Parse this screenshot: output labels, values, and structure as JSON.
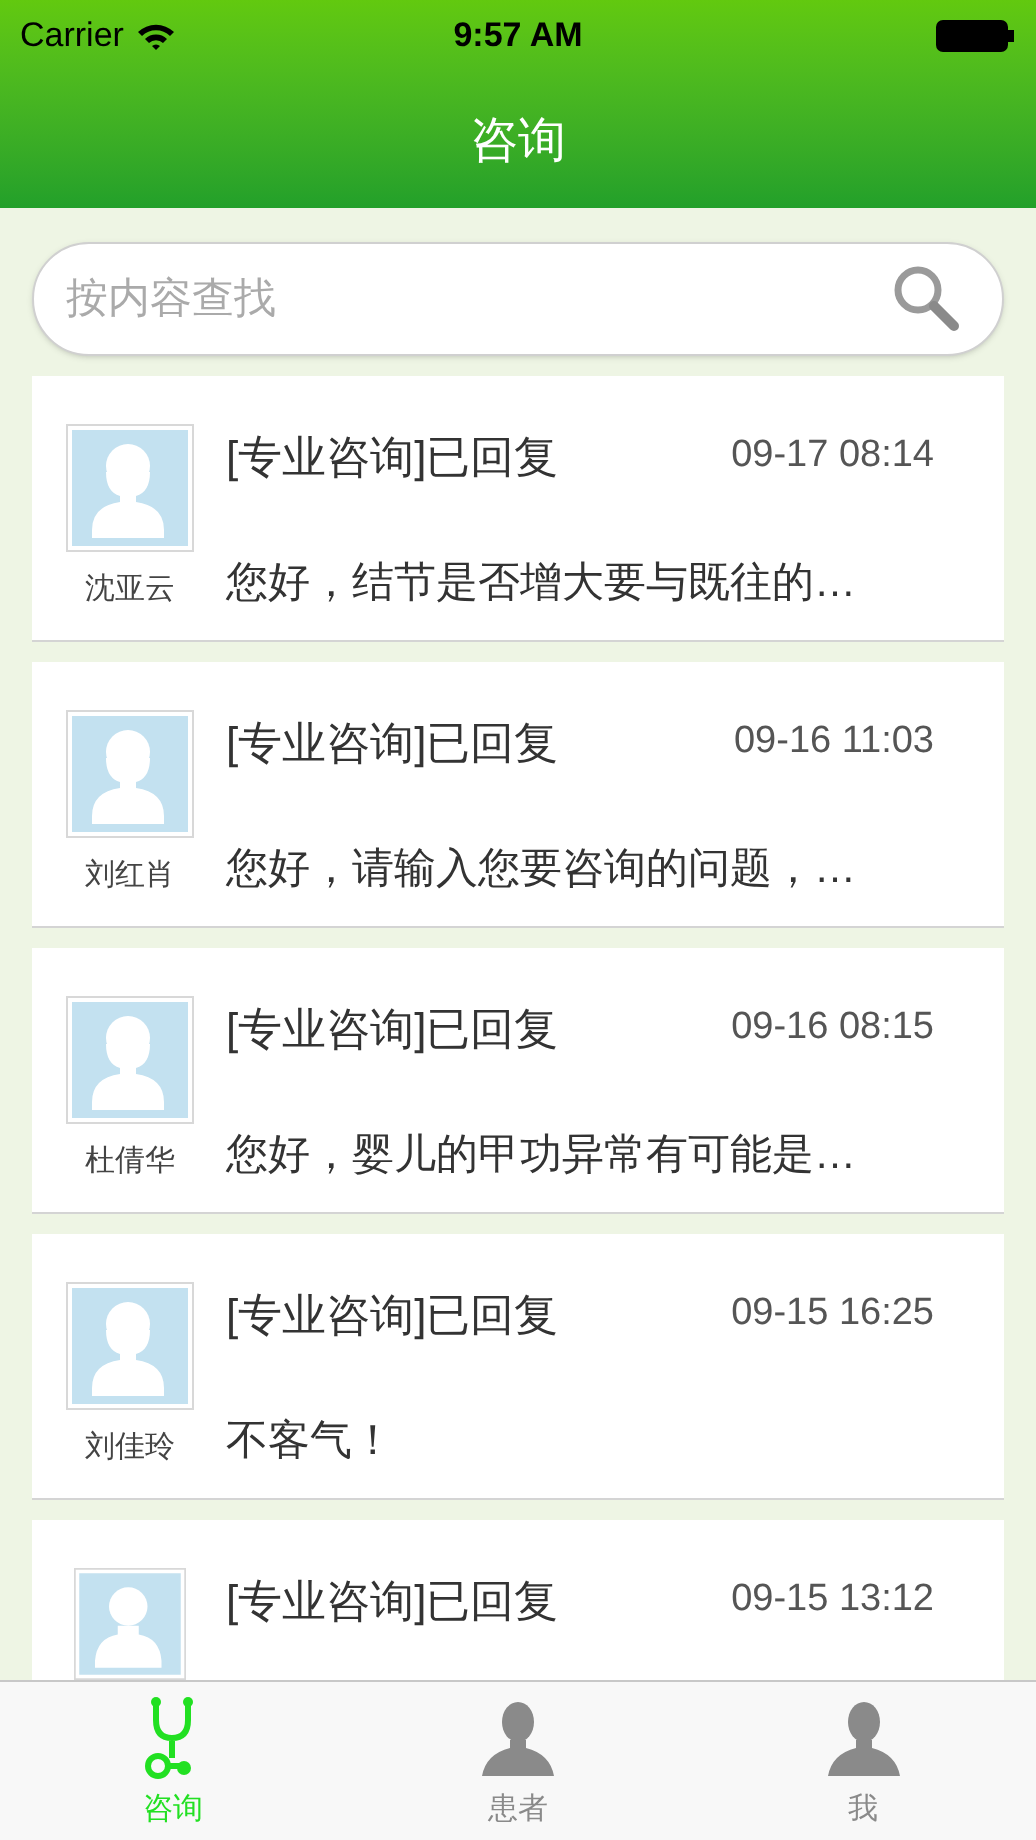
{
  "status_bar": {
    "carrier": "Carrier",
    "time": "9:57 AM"
  },
  "nav": {
    "title": "咨询"
  },
  "search": {
    "placeholder": "按内容查找"
  },
  "consultations": [
    {
      "avatar": {
        "kind": "female"
      },
      "name": "沈亚云",
      "title": "[专业咨询]已回复",
      "time": "09-17 08:14",
      "message": "您好，结节是否增大要与既往的…"
    },
    {
      "avatar": {
        "kind": "female"
      },
      "name": "刘红肖",
      "title": "[专业咨询]已回复",
      "time": "09-16 11:03",
      "message": "您好，请输入您要咨询的问题，…"
    },
    {
      "avatar": {
        "kind": "female"
      },
      "name": "杜倩华",
      "title": "[专业咨询]已回复",
      "time": "09-16 08:15",
      "message": "您好，婴儿的甲功异常有可能是…"
    },
    {
      "avatar": {
        "kind": "female"
      },
      "name": "刘佳玲",
      "title": "[专业咨询]已回复",
      "time": "09-15 16:25",
      "message": "不客气！"
    },
    {
      "avatar": {
        "kind": "male"
      },
      "title": "[专业咨询]已回复",
      "time": "09-15 13:12"
    }
  ],
  "tab_bar": [
    {
      "kind": "stethoscope",
      "label": "咨询",
      "selected": true
    },
    {
      "kind": "person",
      "label": "患者",
      "selected": false
    },
    {
      "kind": "person",
      "label": "我",
      "selected": false
    }
  ]
}
